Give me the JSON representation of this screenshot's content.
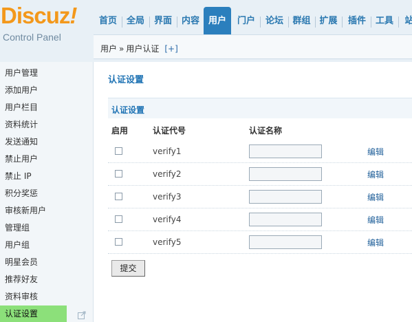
{
  "logo": {
    "word": "Discuz",
    "mark": "!",
    "subtitle": "Control Panel"
  },
  "nav": {
    "items": [
      {
        "label": "首页"
      },
      {
        "label": "全局"
      },
      {
        "label": "界面"
      },
      {
        "label": "内容"
      },
      {
        "label": "用户",
        "active": true
      },
      {
        "label": "门户"
      },
      {
        "label": "论坛"
      },
      {
        "label": "群组"
      },
      {
        "label": "扩展"
      },
      {
        "label": "插件"
      },
      {
        "label": "工具"
      },
      {
        "label": "站"
      }
    ],
    "active_color": "#2b7fbd"
  },
  "breadcrumb": {
    "root": "用户",
    "separator": "»",
    "current": "用户认证",
    "add_label": "[+]"
  },
  "sidebar": {
    "items": [
      {
        "label": "用户管理"
      },
      {
        "label": "添加用户"
      },
      {
        "label": "用户栏目"
      },
      {
        "label": "资料统计"
      },
      {
        "label": "发送通知"
      },
      {
        "label": "禁止用户"
      },
      {
        "label": "禁止 IP"
      },
      {
        "label": "积分奖惩"
      },
      {
        "label": "审核新用户"
      },
      {
        "label": "管理组"
      },
      {
        "label": "用户组"
      },
      {
        "label": "明星会员"
      },
      {
        "label": "推荐好友"
      },
      {
        "label": "资料审核"
      },
      {
        "label": "认证设置",
        "active": true
      }
    ],
    "popout_icon": "popout-icon",
    "active_color": "#8ce07a"
  },
  "main": {
    "page_title": "认证设置",
    "section_title": "认证设置",
    "columns": {
      "enable": "启用",
      "code": "认证代号",
      "name": "认证名称"
    },
    "rows": [
      {
        "code": "verify1",
        "name_value": "",
        "edit_label": "编辑"
      },
      {
        "code": "verify2",
        "name_value": "",
        "edit_label": "编辑"
      },
      {
        "code": "verify3",
        "name_value": "",
        "edit_label": "编辑"
      },
      {
        "code": "verify4",
        "name_value": "",
        "edit_label": "编辑"
      },
      {
        "code": "verify5",
        "name_value": "",
        "edit_label": "编辑"
      }
    ],
    "submit_label": "提交"
  }
}
